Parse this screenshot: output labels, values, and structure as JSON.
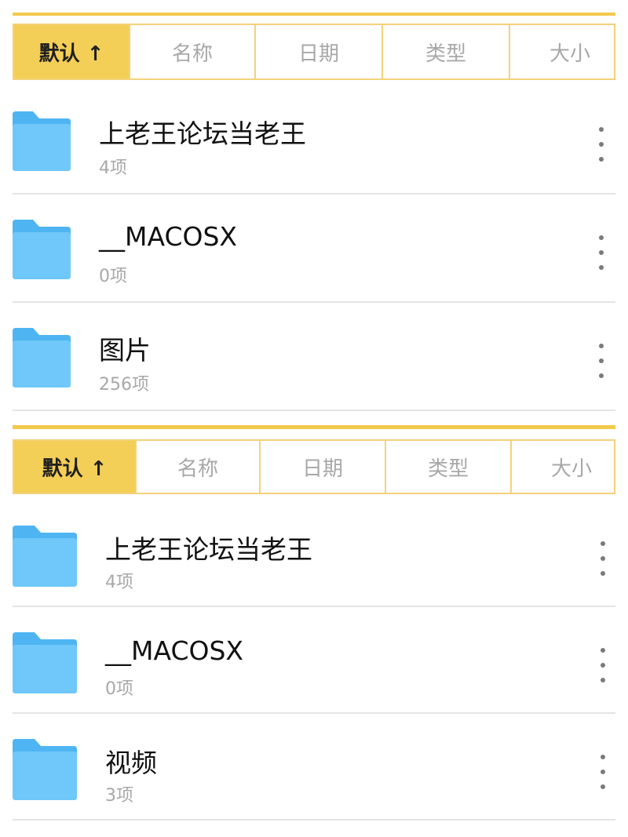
{
  "colors": {
    "accent": "#f4cf57",
    "accent_border": "#f3d27a",
    "folder_back": "#4fb5f2",
    "folder_front": "#6fc8f9",
    "muted_text": "#a8a8a8",
    "divider": "#e4e4e4"
  },
  "panels": [
    {
      "sort_tabs": [
        {
          "label": "默认 ↑",
          "active": true
        },
        {
          "label": "名称",
          "active": false
        },
        {
          "label": "日期",
          "active": false
        },
        {
          "label": "类型",
          "active": false
        },
        {
          "label": "大小",
          "active": false
        }
      ],
      "items": [
        {
          "name": "上老王论坛当老王",
          "count": "4项",
          "icon": "folder-icon"
        },
        {
          "name": "__MACOSX",
          "count": "0项",
          "icon": "folder-icon"
        },
        {
          "name": "图片",
          "count": "256项",
          "icon": "folder-icon"
        }
      ]
    },
    {
      "sort_tabs": [
        {
          "label": "默认 ↑",
          "active": true
        },
        {
          "label": "名称",
          "active": false
        },
        {
          "label": "日期",
          "active": false
        },
        {
          "label": "类型",
          "active": false
        },
        {
          "label": "大小",
          "active": false
        }
      ],
      "items": [
        {
          "name": "上老王论坛当老王",
          "count": "4项",
          "icon": "folder-icon"
        },
        {
          "name": "__MACOSX",
          "count": "0项",
          "icon": "folder-icon"
        },
        {
          "name": "视频",
          "count": "3项",
          "icon": "folder-icon"
        }
      ]
    }
  ]
}
